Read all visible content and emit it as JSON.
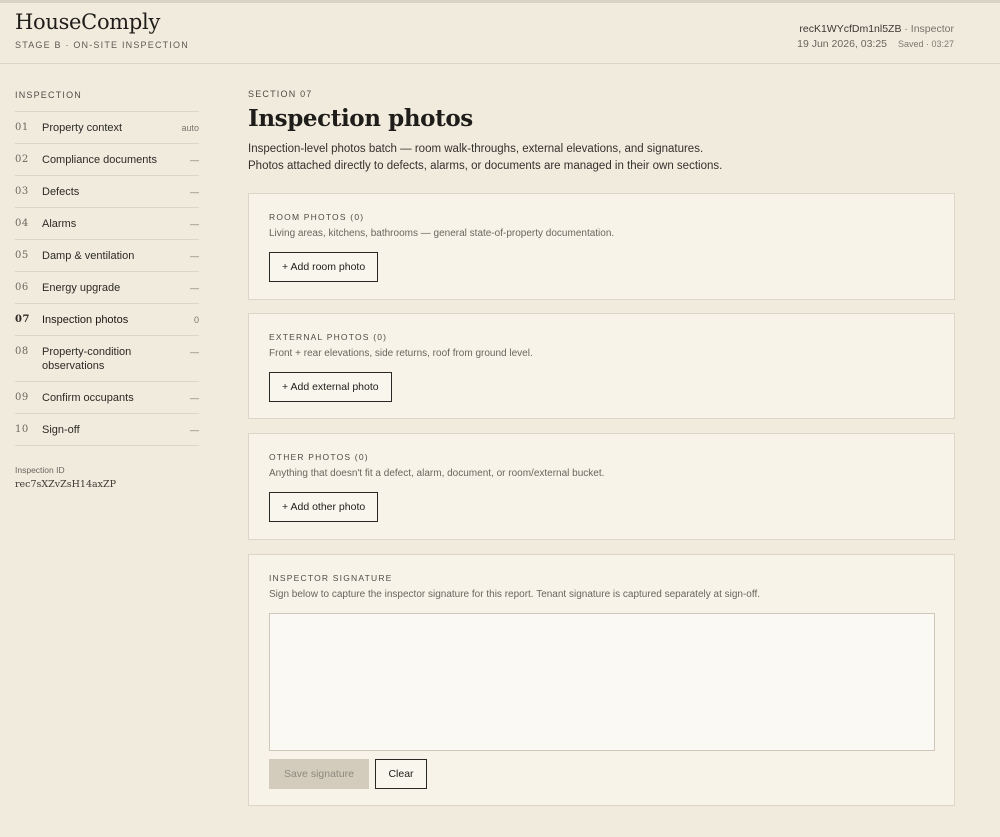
{
  "header": {
    "brand": "HouseComply",
    "stage": "STAGE B · ON-SITE INSPECTION",
    "record_id": "recK1WYcfDm1nl5ZB",
    "role": "· Inspector",
    "datetime": "19 Jun 2026, 03:25",
    "saved": "Saved · 03:27"
  },
  "sidebar": {
    "heading": "INSPECTION",
    "items": [
      {
        "num": "01",
        "label": "Property context",
        "status": "auto"
      },
      {
        "num": "02",
        "label": "Compliance documents",
        "status": "—"
      },
      {
        "num": "03",
        "label": "Defects",
        "status": "—"
      },
      {
        "num": "04",
        "label": "Alarms",
        "status": "—"
      },
      {
        "num": "05",
        "label": "Damp & ventilation",
        "status": "—"
      },
      {
        "num": "06",
        "label": "Energy upgrade",
        "status": "—"
      },
      {
        "num": "07",
        "label": "Inspection photos",
        "status": "0"
      },
      {
        "num": "08",
        "label": "Property-condition observations",
        "status": "—"
      },
      {
        "num": "09",
        "label": "Confirm occupants",
        "status": "—"
      },
      {
        "num": "10",
        "label": "Sign-off",
        "status": "—"
      }
    ],
    "active_index": 6,
    "inspection_id_label": "Inspection ID",
    "inspection_id": "rec7sXZvZsH14axZP"
  },
  "main": {
    "eyebrow": "SECTION 07",
    "title": "Inspection photos",
    "intro_line1": "Inspection-level photos batch — room walk-throughs, external elevations, and signatures.",
    "intro_line2": "Photos attached directly to defects, alarms, or documents are managed in their own sections.",
    "room": {
      "title": "ROOM PHOTOS (0)",
      "desc": "Living areas, kitchens, bathrooms — general state-of-property documentation.",
      "button": "+ Add room photo"
    },
    "external": {
      "title": "EXTERNAL PHOTOS (0)",
      "desc": "Front + rear elevations, side returns, roof from ground level.",
      "button": "+ Add external photo"
    },
    "other": {
      "title": "OTHER PHOTOS (0)",
      "desc": "Anything that doesn't fit a defect, alarm, document, or room/external bucket.",
      "button": "+ Add other photo"
    },
    "signature": {
      "title": "INSPECTOR SIGNATURE",
      "desc": "Sign below to capture the inspector signature for this report. Tenant signature is captured separately at sign-off.",
      "save": "Save signature",
      "clear": "Clear"
    }
  }
}
